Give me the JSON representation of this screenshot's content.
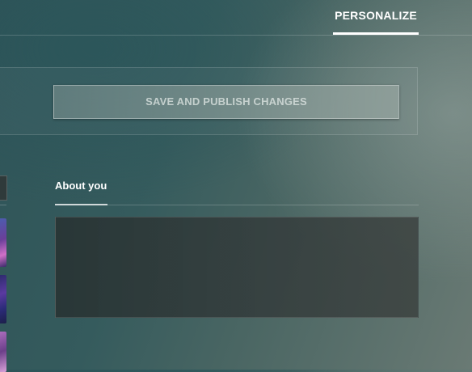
{
  "header": {
    "active_tab": "PERSONALIZE"
  },
  "actions": {
    "save_label": "SAVE AND PUBLISH CHANGES"
  },
  "about": {
    "title": "About you",
    "value": "",
    "placeholder": ""
  },
  "colors": {
    "accent": "#ffffff",
    "button_text": "#d8e0de",
    "textarea_bg": "#303a3a"
  }
}
